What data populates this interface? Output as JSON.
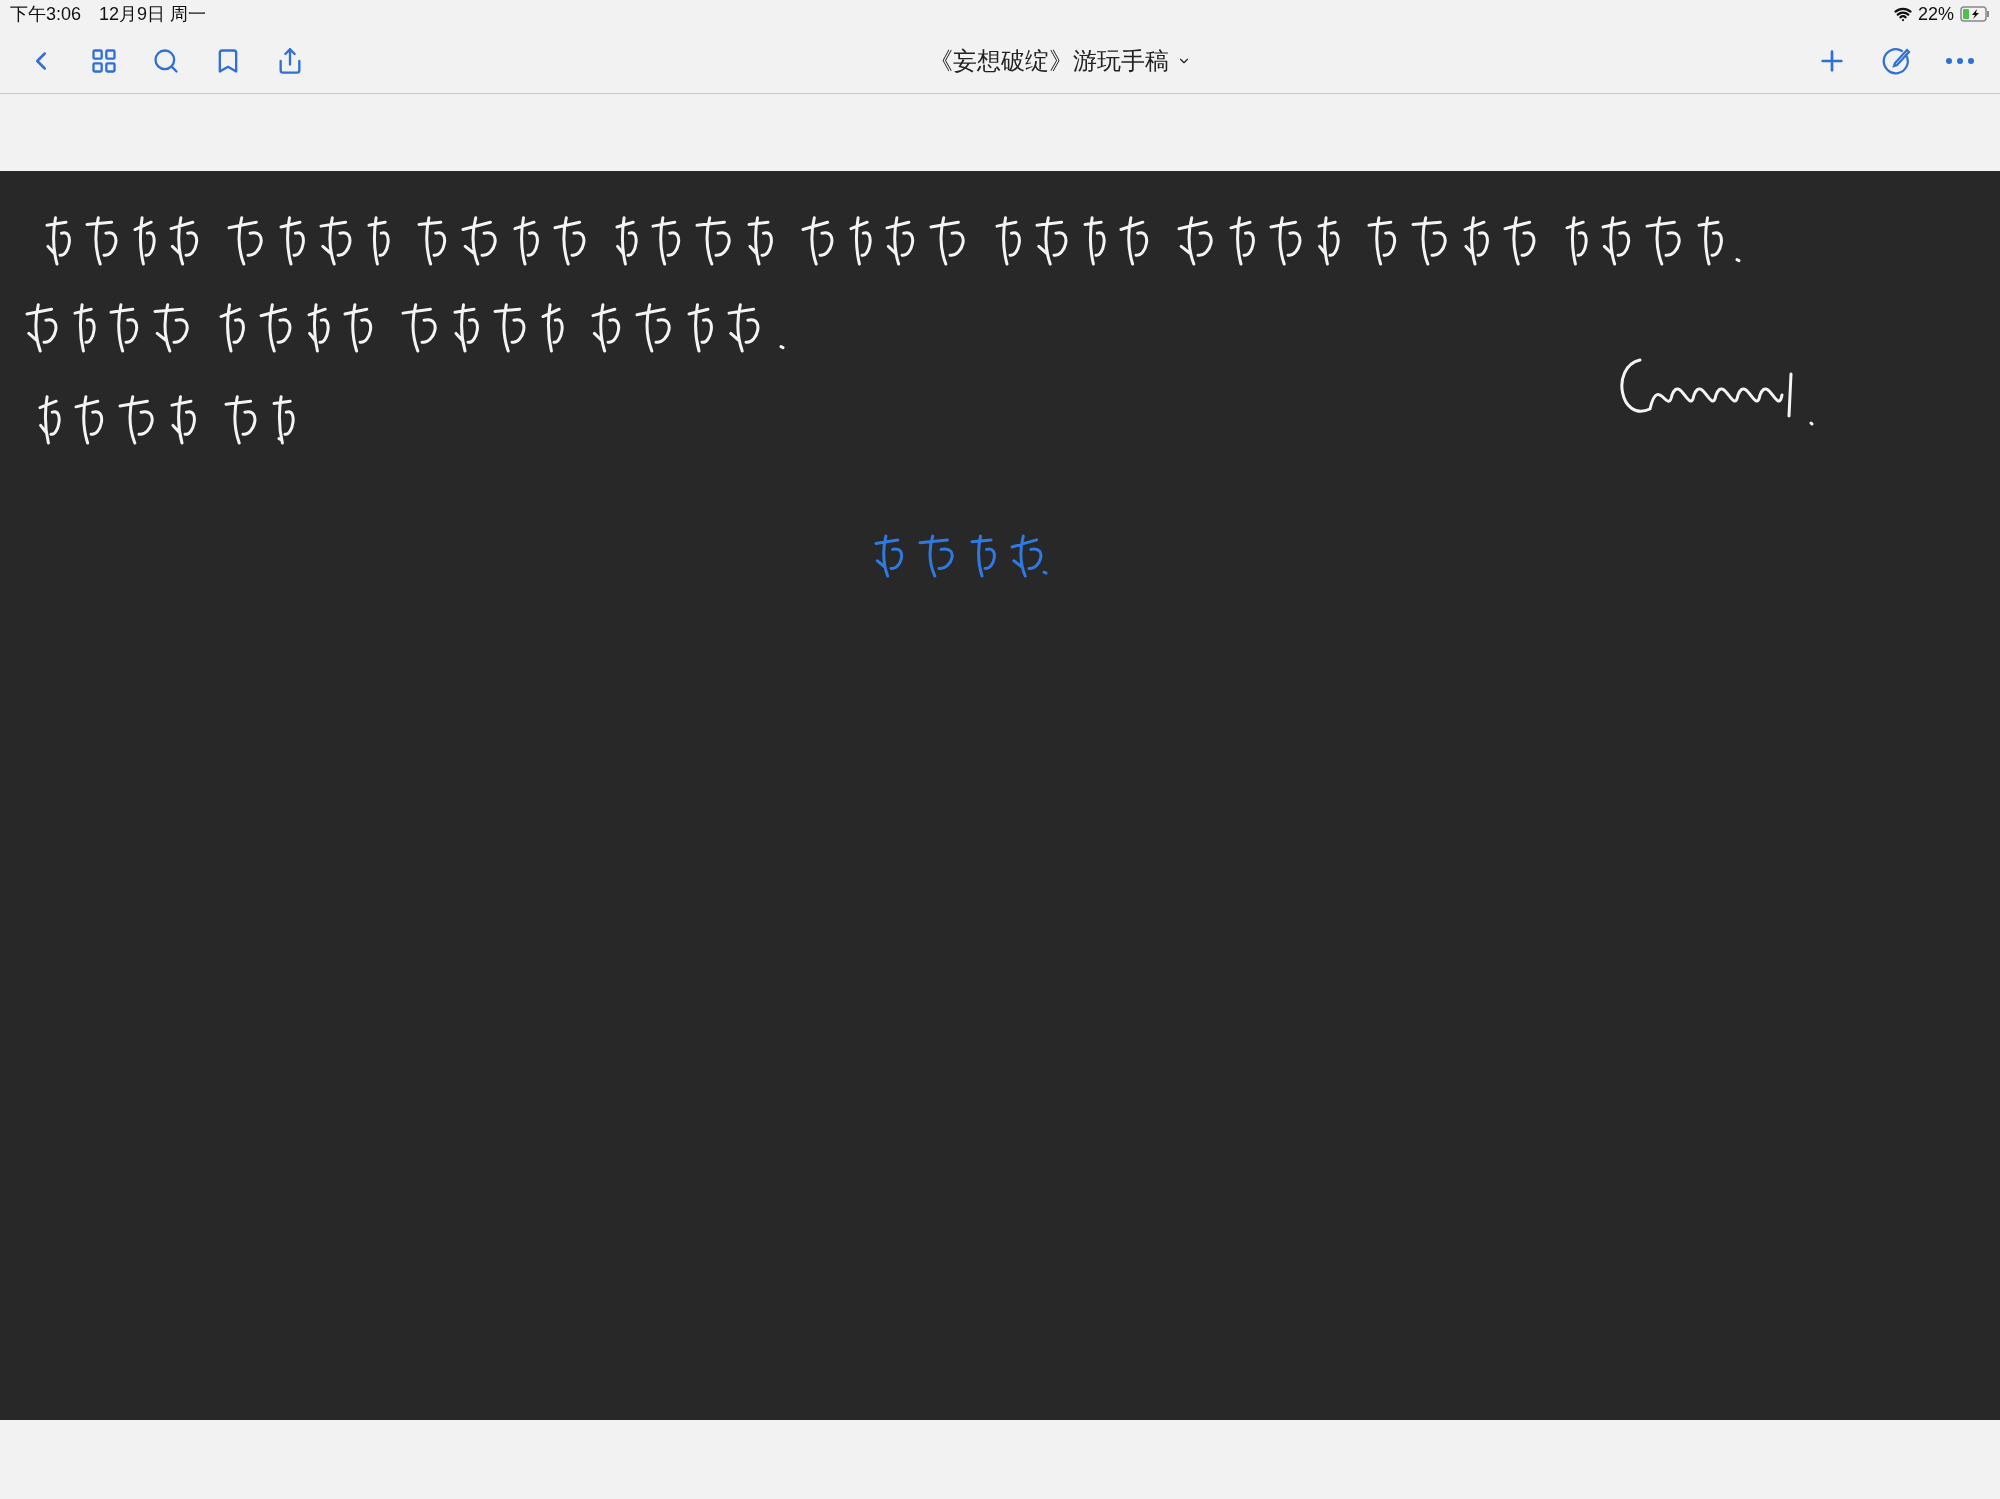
{
  "status_bar": {
    "time": "下午3:06",
    "date": "12月9日 周一",
    "battery": "22%"
  },
  "toolbar": {
    "title": "《妄想破绽》游玩手稿"
  },
  "page": {
    "kind": "notebook-page"
  }
}
